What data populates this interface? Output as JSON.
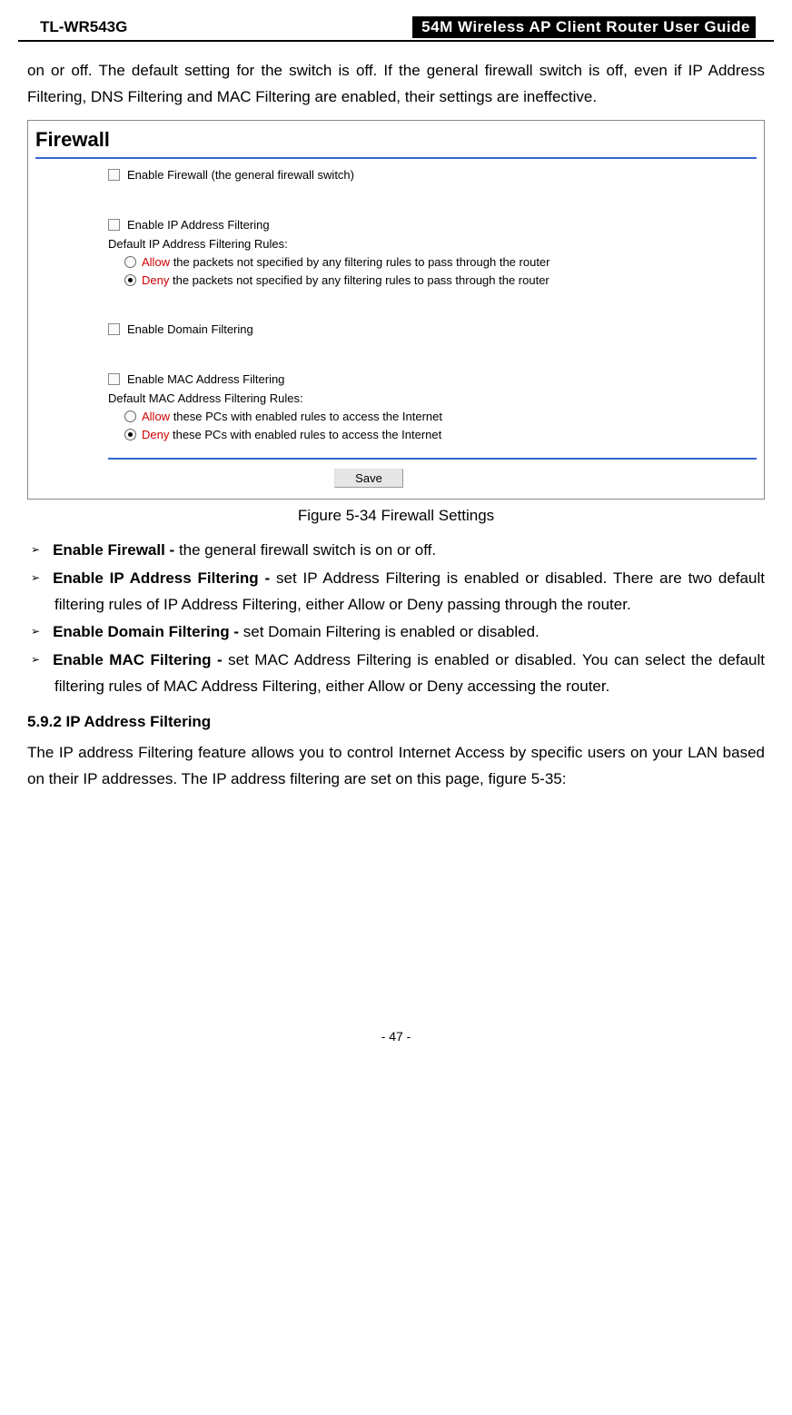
{
  "header": {
    "model": "TL-WR543G",
    "title": "54M Wireless AP Client Router User Guide"
  },
  "intro": "on or off. The default setting for the switch is off. If the general firewall switch is off, even if IP Address Filtering, DNS Filtering and MAC Filtering are enabled, their settings are ineffective.",
  "figure": {
    "title": "Firewall",
    "enable_firewall": "Enable Firewall (the general firewall switch)",
    "enable_ip": "Enable IP Address Filtering",
    "ip_rules_label": "Default IP Address Filtering Rules:",
    "ip_allow_prefix": "Allow",
    "ip_allow_rest": " the packets not specified by any filtering rules to pass through the router",
    "ip_deny_prefix": "Deny",
    "ip_deny_rest": " the packets not specified by any filtering rules to pass through the router",
    "enable_domain": "Enable Domain Filtering",
    "enable_mac": "Enable MAC Address Filtering",
    "mac_rules_label": "Default MAC Address Filtering Rules:",
    "mac_allow_prefix": "Allow",
    "mac_allow_rest": " these PCs with enabled rules to access the Internet",
    "mac_deny_prefix": "Deny",
    "mac_deny_rest": " these PCs with enabled rules to access the Internet",
    "save": "Save"
  },
  "caption": "Figure 5-34    Firewall Settings",
  "bullets": {
    "b1_term": "Enable Firewall - ",
    "b1_rest": "the general firewall switch is on or off.",
    "b2_term": "Enable IP Address Filtering - ",
    "b2_rest": "set IP Address Filtering is enabled or disabled. There are two default filtering rules of IP Address Filtering, either Allow or Deny passing through the router.",
    "b3_term": "Enable Domain Filtering - ",
    "b3_rest": "set Domain Filtering is enabled or disabled.",
    "b4_term": "Enable MAC Filtering - ",
    "b4_rest": "set MAC Address Filtering is enabled or disabled. You can select the default filtering rules of MAC Address Filtering, either Allow or Deny accessing the router."
  },
  "subhead": "5.9.2 IP Address Filtering",
  "bodypara": "The IP address Filtering feature allows you to control Internet Access by specific users on your LAN based on their IP addresses. The IP address filtering are set on this page, figure 5-35:",
  "page": "- 47 -"
}
